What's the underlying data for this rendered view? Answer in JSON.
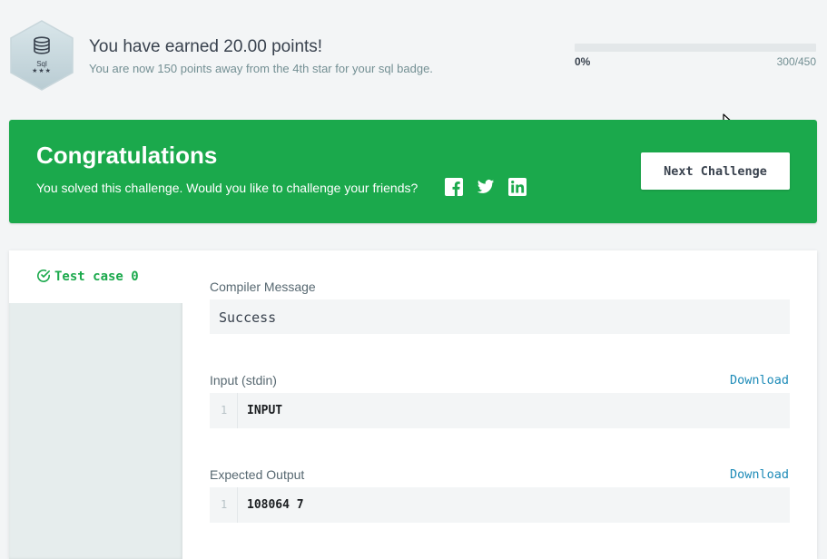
{
  "badge": {
    "name": "Sql",
    "stars": "★★★",
    "icon": "database-icon"
  },
  "earned": {
    "title": "You have earned 20.00 points!",
    "subtitle": "You are now 150 points away from the 4th star for your sql badge."
  },
  "progress": {
    "min_label": "0%",
    "max_label": "300/450",
    "fraction": 0
  },
  "banner": {
    "title": "Congratulations",
    "subtitle": "You solved this challenge. Would you like to challenge your friends?",
    "social_icons": [
      "facebook-icon",
      "twitter-icon",
      "linkedin-icon"
    ],
    "next_button": "Next Challenge",
    "color": "#1ba94c"
  },
  "tests": {
    "tabs": [
      {
        "label": "Test case 0",
        "status": "passed",
        "icon": "check-circle-icon"
      }
    ],
    "compiler_message": {
      "label": "Compiler Message",
      "value": "Success"
    },
    "input": {
      "label": "Input (stdin)",
      "download": "Download",
      "lines": [
        {
          "no": "1",
          "text": "INPUT"
        }
      ]
    },
    "expected_output": {
      "label": "Expected Output",
      "download": "Download",
      "lines": [
        {
          "no": "1",
          "text": "108064 7"
        }
      ]
    }
  },
  "colors": {
    "accent_green": "#1ba94c",
    "link_blue": "#1d8bb8",
    "text_dark": "#39424e",
    "text_muted": "#738f93"
  }
}
